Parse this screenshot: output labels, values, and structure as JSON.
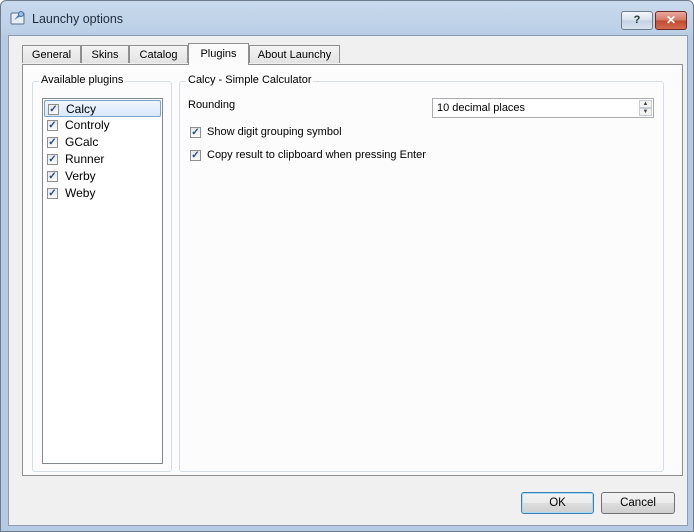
{
  "window": {
    "title": "Launchy options",
    "help_label": "?",
    "close_label": "✕"
  },
  "tabs": [
    {
      "label": "General"
    },
    {
      "label": "Skins"
    },
    {
      "label": "Catalog"
    },
    {
      "label": "Plugins"
    },
    {
      "label": "About Launchy"
    }
  ],
  "active_tab": "Plugins",
  "plugins": {
    "group_title": "Available plugins",
    "items": [
      {
        "label": "Calcy",
        "checked": true,
        "selected": true
      },
      {
        "label": "Controly",
        "checked": true
      },
      {
        "label": "GCalc",
        "checked": true
      },
      {
        "label": "Runner",
        "checked": true
      },
      {
        "label": "Verby",
        "checked": true
      },
      {
        "label": "Weby",
        "checked": true
      }
    ]
  },
  "settings": {
    "group_title": "Calcy - Simple Calculator",
    "rounding_label": "Rounding",
    "rounding_value": "10 decimal places",
    "options": [
      {
        "label": "Show digit grouping symbol",
        "checked": true
      },
      {
        "label": "Copy result to clipboard when pressing Enter",
        "checked": true
      }
    ]
  },
  "buttons": {
    "ok": "OK",
    "cancel": "Cancel"
  },
  "check_glyph": "✓",
  "icons": {
    "app": "launchy-app-icon",
    "spin_up": "spin-up-arrow-icon",
    "spin_down": "spin-down-arrow-icon"
  }
}
